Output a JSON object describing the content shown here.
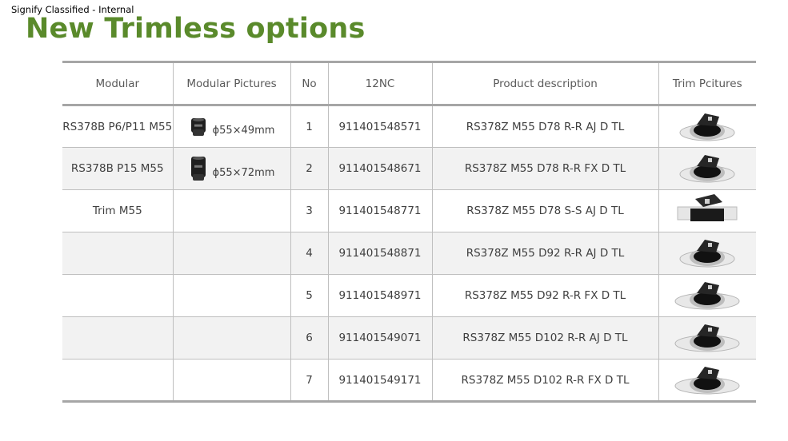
{
  "header": {
    "classification": "Signify Classified - Internal",
    "title": "New Trimless options"
  },
  "table": {
    "columns": [
      "Modular",
      "Modular Pictures",
      "No",
      "12NC",
      "Product description",
      "Trim Pcitures"
    ],
    "rows": [
      {
        "modular": "RS378B P6/P11 M55",
        "modular_picture_dim": "ϕ55×49mm",
        "no": "1",
        "nc": "911401548571",
        "description": "RS378Z M55 D78 R-R AJ D TL"
      },
      {
        "modular": "RS378B P15 M55",
        "modular_picture_dim": "ϕ55×72mm",
        "no": "2",
        "nc": "911401548671",
        "description": "RS378Z M55 D78 R-R FX D TL"
      },
      {
        "modular": "Trim M55",
        "modular_picture_dim": "",
        "no": "3",
        "nc": "911401548771",
        "description": "RS378Z M55 D78 S-S AJ D TL"
      },
      {
        "modular": "",
        "modular_picture_dim": "",
        "no": "4",
        "nc": "911401548871",
        "description": "RS378Z M55 D92 R-R AJ D TL"
      },
      {
        "modular": "",
        "modular_picture_dim": "",
        "no": "5",
        "nc": "911401548971",
        "description": "RS378Z M55 D92 R-R FX D TL"
      },
      {
        "modular": "",
        "modular_picture_dim": "",
        "no": "6",
        "nc": "911401549071",
        "description": "RS378Z M55 D102 R-R AJ D TL"
      },
      {
        "modular": "",
        "modular_picture_dim": "",
        "no": "7",
        "nc": "911401549171",
        "description": "RS378Z M55 D102 R-R FX D TL"
      }
    ]
  }
}
